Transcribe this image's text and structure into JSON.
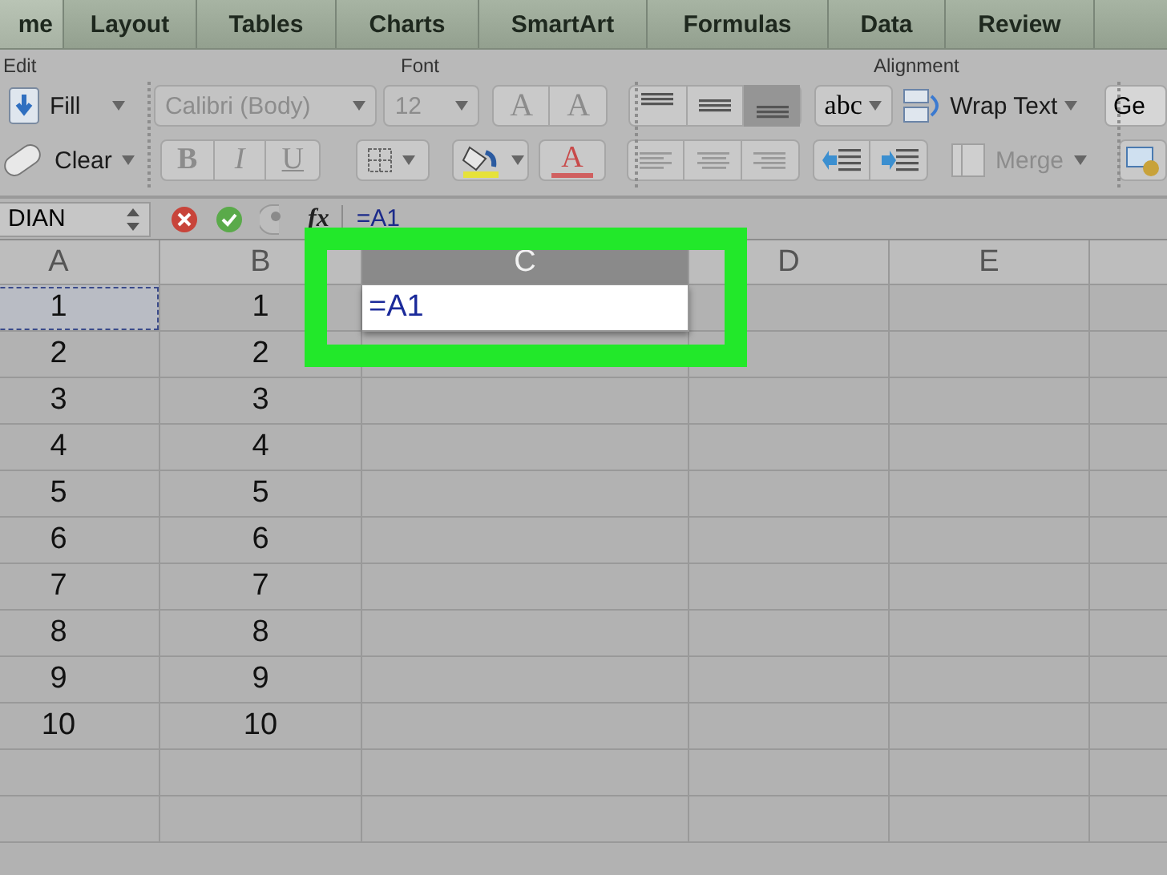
{
  "tabs": [
    {
      "label": "me",
      "selected": true
    },
    {
      "label": "Layout",
      "selected": false
    },
    {
      "label": "Tables",
      "selected": false
    },
    {
      "label": "Charts",
      "selected": false
    },
    {
      "label": "SmartArt",
      "selected": false
    },
    {
      "label": "Formulas",
      "selected": false
    },
    {
      "label": "Data",
      "selected": false
    },
    {
      "label": "Review",
      "selected": false
    }
  ],
  "ribbon": {
    "groups": [
      "Edit",
      "Font",
      "Alignment"
    ],
    "row_1": [
      {
        "kind": "fill",
        "label": "Fill"
      },
      {
        "kind": "select",
        "value": "Calibri (Body)",
        "disabled": true
      },
      {
        "kind": "select",
        "value": "12",
        "disabled": true
      },
      {
        "kind": "glyph-pair",
        "glyphs": [
          "A",
          "A"
        ],
        "disabled": true
      },
      {
        "kind": "align",
        "buttons": [
          {
            "selected": false
          },
          {
            "selected": false
          },
          {
            "selected": true
          }
        ]
      },
      {
        "kind": "text-button",
        "label": "abc"
      },
      {
        "kind": "wrap",
        "label": "Wrap Text"
      },
      {
        "kind": "field",
        "value": "Ge"
      }
    ],
    "row_2": [
      {
        "kind": "clear",
        "label": "Clear"
      },
      {
        "kind": "styles",
        "glyphs": [
          "B",
          "I",
          "U"
        ],
        "disabled": true
      },
      {
        "kind": "borders"
      },
      {
        "kind": "fill-color"
      },
      {
        "kind": "font-color",
        "glyph": "A"
      },
      {
        "kind": "halign"
      },
      {
        "kind": "indent"
      },
      {
        "kind": "merge",
        "label": "Merge",
        "disabled": true
      },
      {
        "kind": "format-icon"
      }
    ]
  },
  "formula_bar": {
    "name_box": "DIAN",
    "fx": "fx",
    "formula": "=A1"
  },
  "sheet": {
    "columns": [
      "A",
      "B",
      "C",
      "D",
      "E"
    ],
    "rows": [
      [
        {
          "text": "1",
          "marquee": true
        },
        {
          "text": "1"
        },
        {
          "text": "=A1",
          "editing": true
        }
      ],
      [
        {
          "text": "2"
        },
        {
          "text": "2"
        }
      ],
      [
        {
          "text": "3"
        },
        {
          "text": "3"
        }
      ],
      [
        {
          "text": "4"
        },
        {
          "text": "4"
        }
      ],
      [
        {
          "text": "5"
        },
        {
          "text": "5"
        }
      ],
      [
        {
          "text": "6"
        },
        {
          "text": "6"
        }
      ],
      [
        {
          "text": "7"
        },
        {
          "text": "7"
        }
      ],
      [
        {
          "text": "8"
        },
        {
          "text": "8"
        }
      ],
      [
        {
          "text": "9"
        },
        {
          "text": "9"
        }
      ],
      [
        {
          "text": "10"
        },
        {
          "text": "10"
        }
      ]
    ]
  }
}
